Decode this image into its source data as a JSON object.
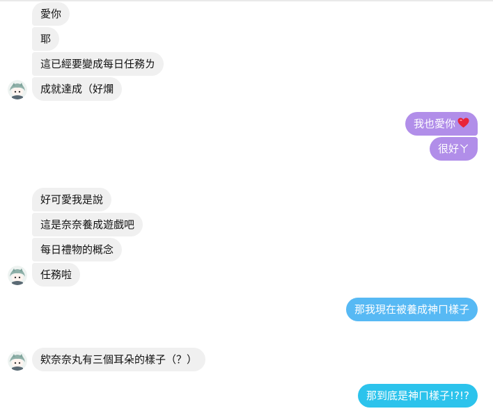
{
  "colors": {
    "incoming_bg": "#f0f0f0",
    "purple": "#b18ee9",
    "blue": "#57b9f4",
    "cyan": "#2cc3ec",
    "heart": "#e8243a"
  },
  "groups": {
    "g1": {
      "m1": "愛你",
      "m2": "耶",
      "m3": "這已經要變成每日任務ㄌ",
      "m4": "成就達成（好爛"
    },
    "g2": {
      "m1": "我也愛你",
      "m1_icon": "heart-emoji",
      "m2": "很好ㄚ"
    },
    "g3": {
      "m1": "好可愛我是說",
      "m2": "這是奈奈養成遊戲吧",
      "m3": "每日禮物的概念",
      "m4": "任務啦"
    },
    "g4": {
      "m1": "那我現在被養成神ㄇ樣子"
    },
    "g5": {
      "m1": "欸奈奈丸有三個耳朵的樣子（？）"
    },
    "g6": {
      "m1": "那到底是神ㄇ樣子!?!?"
    }
  }
}
